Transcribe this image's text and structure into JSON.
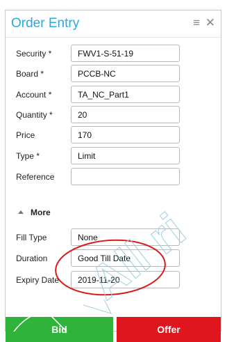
{
  "window": {
    "title": "Order Entry",
    "menu_icon": "hamburger-menu-icon",
    "close_icon": "close-icon"
  },
  "fields": [
    {
      "label": "Security *",
      "value": "FWV1-S-51-19"
    },
    {
      "label": "Board *",
      "value": "PCCB-NC"
    },
    {
      "label": "Account *",
      "value": "TA_NC_Part1"
    },
    {
      "label": "Quantity *",
      "value": "20"
    },
    {
      "label": "Price",
      "value": "170"
    },
    {
      "label": "Type *",
      "value": "Limit"
    },
    {
      "label": "Reference",
      "value": ""
    }
  ],
  "more": {
    "label": "More",
    "expanded": true
  },
  "more_fields": [
    {
      "label": "Fill Type",
      "value": "None"
    },
    {
      "label": "Duration",
      "value": "Good Till Date"
    },
    {
      "label": "Expiry Date",
      "value": "2019-11-20"
    }
  ],
  "actions": {
    "bid_label": "Bid",
    "offer_label": "Offer",
    "bid_color": "#2fb33b",
    "offer_color": "#e0161f"
  },
  "colors": {
    "title": "#29a9e0",
    "annotation": "#d81b1b"
  },
  "watermark": {
    "text": "All ri"
  }
}
